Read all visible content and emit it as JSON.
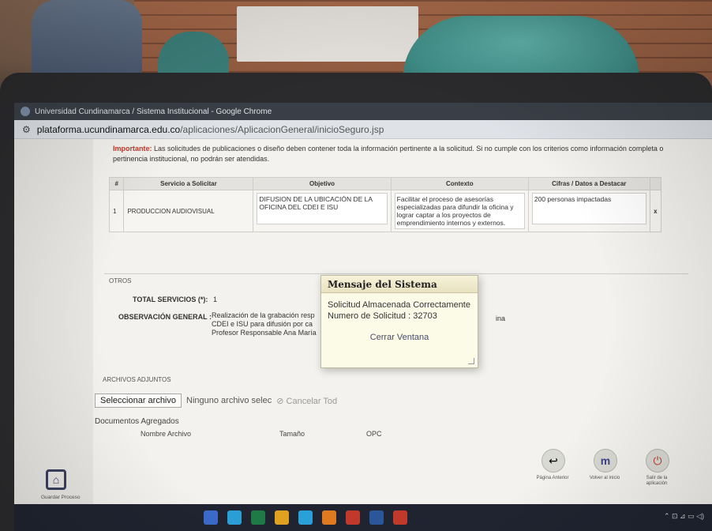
{
  "browser": {
    "window_title": "Universidad Cundinamarca / Sistema Institucional - Google Chrome",
    "url_host": "plataforma.ucundinamarca.edu.co",
    "url_path": "/aplicaciones/AplicacionGeneral/inicioSeguro.jsp"
  },
  "notice": {
    "label": "Importante:",
    "text": "Las solicitudes de publicaciones o diseño deben contener toda la información pertinente a la solicitud. Si no cumple con los criterios como información completa o pertinencia institucional, no podrán ser atendidas."
  },
  "services_table": {
    "headers": [
      "#",
      "Servicio a Solicitar",
      "Objetivo",
      "Contexto",
      "Cifras / Datos a Destacar"
    ],
    "rows": [
      {
        "num": "1",
        "service": "PRODUCCION AUDIOVISUAL",
        "objective": "DIFUSION DE LA UBICACIÓN DE LA OFICINA DEL CDEI E ISU",
        "context": "Facilitar el proceso de asesorías especializadas para difundir la oficina y lograr captar a los proyectos de emprendimiento internos y externos.",
        "figures": "200 personas impactadas",
        "remove": "x"
      }
    ]
  },
  "otros_label": "OTROS",
  "total_services": {
    "label": "TOTAL SERVICIOS (*):",
    "value": "1"
  },
  "observation": {
    "label": "OBSERVACIÓN GENERAL :",
    "line1": "Realización de la grabación resp",
    "line2": "CDEI e ISU  para difusión por ca",
    "line3": "Profesor Responsable Ana María",
    "trailing": "ina"
  },
  "attachments": {
    "label": "ARCHIVOS ADJUNTOS",
    "choose_button": "Seleccionar archivo",
    "no_file_text": "Ninguno archivo selec",
    "cancel_all": "Cancelar Tod",
    "docs_label": "Documentos Agregados",
    "docs_headers": [
      "Nombre Archivo",
      "Tamaño",
      "OPC"
    ]
  },
  "modal": {
    "title": "Mensaje del Sistema",
    "line1": "Solicitud Almacenada Correctamente",
    "line2": "Numero de Solicitud : 32703",
    "close_link": "Cerrar Ventana"
  },
  "actions": {
    "save": "Guardar Proceso",
    "prev": "Página Anterior",
    "home": "Volver al inicio",
    "exit": "Salir de la aplicación"
  }
}
